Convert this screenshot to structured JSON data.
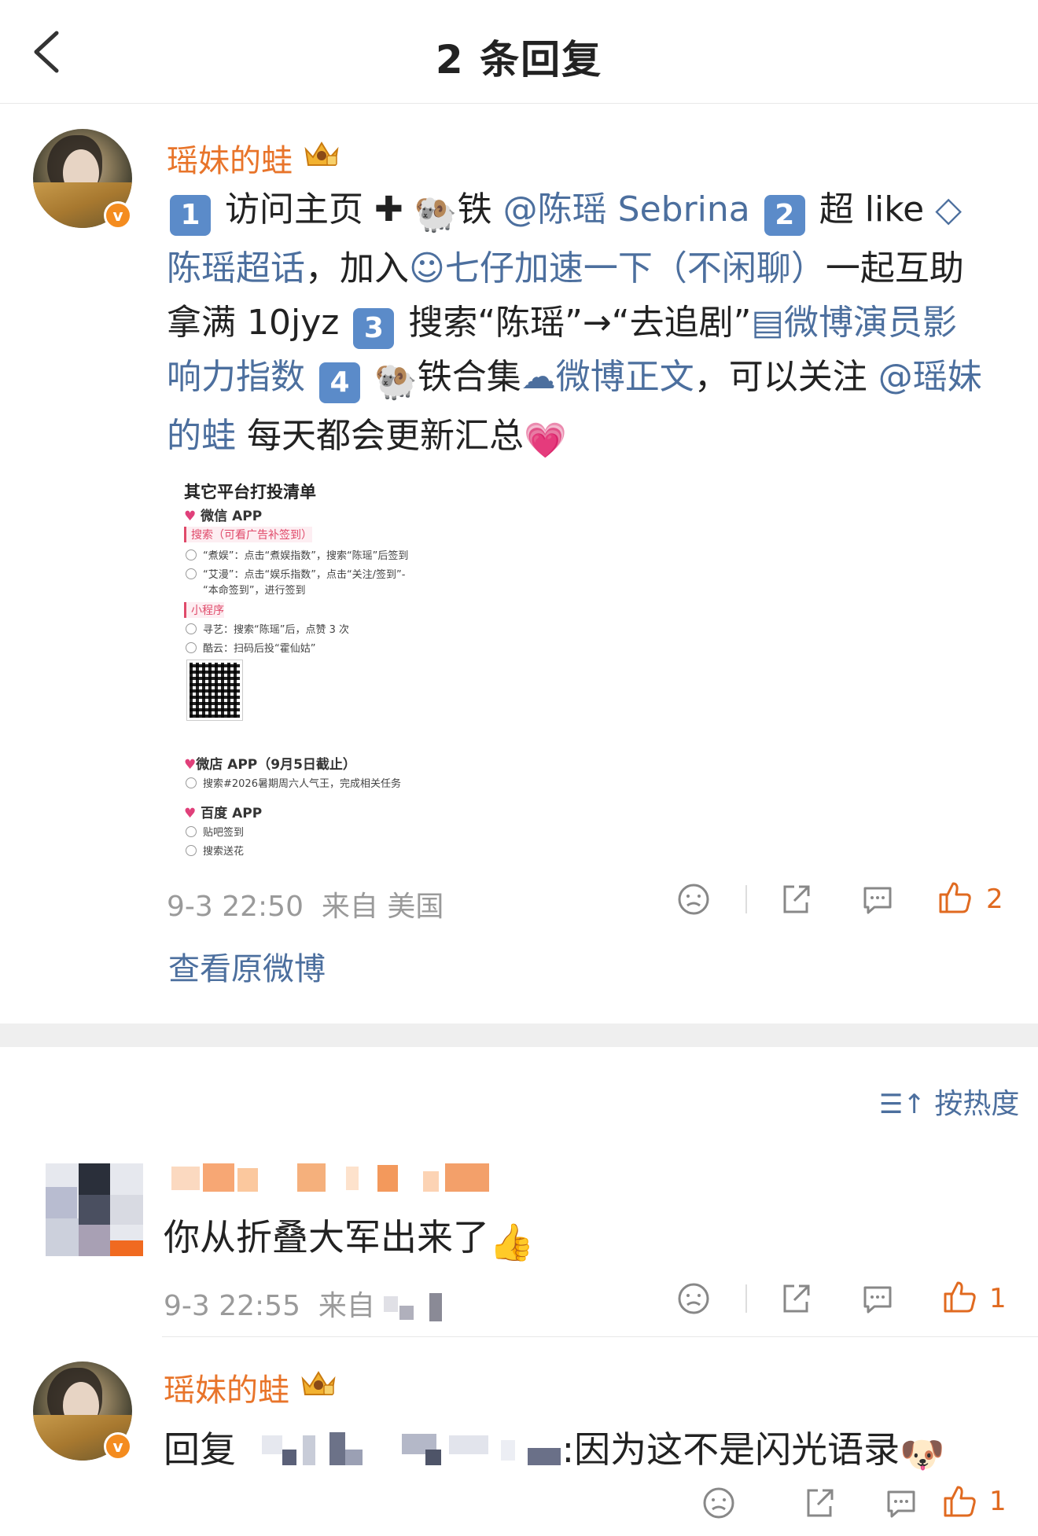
{
  "header": {
    "title": "2 条回复",
    "back_icon": "chevron-left-icon"
  },
  "post": {
    "author": "瑶妹的蛙",
    "text_segments": {
      "s1": "访问主页",
      "s2": "铁",
      "mention1": "@陈瑶 Sebrina",
      "s3": "超 like",
      "topic": "陈瑶超话",
      "s4": "，加入",
      "group": "七仔加速一下（不闲聊）",
      "s5": "一起互助拿满 10jyz",
      "s6": "搜索“陈瑶”→“去追剧”",
      "index_link": "微博演员影响力指数",
      "s7": "铁合集",
      "weibo_link": "微博正文",
      "s8": "，可以关注",
      "mention2": "@瑶妹的蛙",
      "s9": "每天都会更新汇总"
    },
    "badges": [
      "1",
      "2",
      "3",
      "4"
    ],
    "image": {
      "title": "其它平台打投清单",
      "wechat": "微信 APP",
      "search_tag": "搜索（可看广告补签到）",
      "row1": "“煮娱”：点击“煮娱指数”，搜索“陈瑶”后签到",
      "row2": "“艾漫”：点击“娱乐指数”，点击“关注/签到”-",
      "row2b": "“本命签到”，进行签到",
      "mini_tag": "小程序",
      "row3": "寻艺：搜索“陈瑶”后，点赞 3 次",
      "row4": "酷云：扫码后投“霍仙姑”",
      "weidian": "微店 APP（9月5日截止）",
      "row5": "搜索#2026暑期周六人气王，完成相关任务",
      "baidu": "百度 APP",
      "row6": "贴吧签到",
      "row7": "搜索送花"
    },
    "time": "9-3 22:50",
    "from": "来自 美国",
    "like_count": "2"
  },
  "view_original": "查看原微博",
  "sort": {
    "label": "按热度"
  },
  "comment1": {
    "text": "你从折叠大军出来了",
    "time": "9-3 22:55",
    "from": "来自",
    "like_count": "1"
  },
  "comment2": {
    "author": "瑶妹的蛙",
    "reply_prefix": "回复",
    "text": ":因为这不是闪光语录",
    "like_count": "1"
  },
  "colors": {
    "accent": "#4c6f9e",
    "username": "#e8742a",
    "like": "#e06a20"
  }
}
